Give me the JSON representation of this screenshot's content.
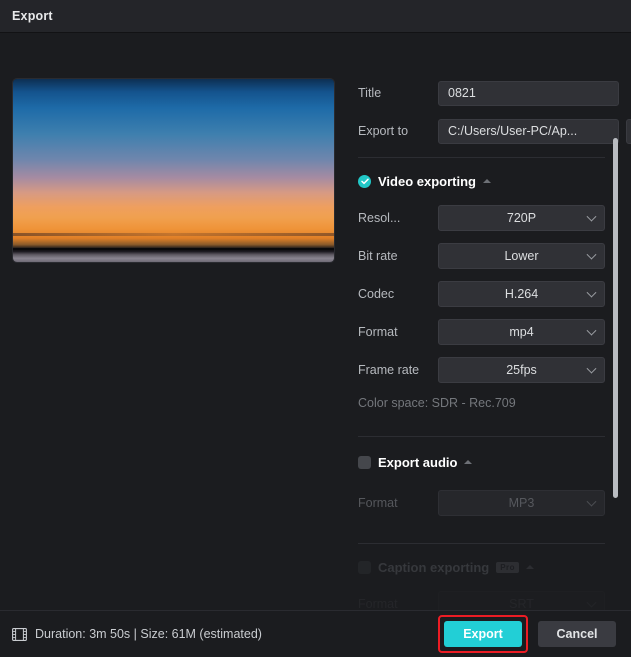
{
  "window": {
    "title": "Export"
  },
  "preview": {
    "name": "video-preview-thumbnail"
  },
  "settings": {
    "title": {
      "label": "Title",
      "value": "0821",
      "placeholder": "Title"
    },
    "export_to": {
      "label": "Export to",
      "value": "C:/Users/User-PC/Ap...",
      "placeholder": "Export path",
      "browse_icon": "folder-icon"
    },
    "video_section": {
      "label": "Video exporting",
      "checked": true,
      "caret": "chevron-up-icon",
      "fields": [
        {
          "label": "Resol...",
          "value": "720P",
          "name": "resolution"
        },
        {
          "label": "Bit rate",
          "value": "Lower",
          "name": "bitrate"
        },
        {
          "label": "Codec",
          "value": "H.264",
          "name": "codec"
        },
        {
          "label": "Format",
          "value": "mp4",
          "name": "video-format"
        },
        {
          "label": "Frame rate",
          "value": "25fps",
          "name": "framerate"
        }
      ],
      "color_space": "Color space: SDR - Rec.709"
    },
    "audio_section": {
      "label": "Export audio",
      "checked": false,
      "caret": "chevron-up-icon",
      "fields": [
        {
          "label": "Format",
          "value": "MP3",
          "name": "audio-format"
        }
      ]
    },
    "caption_section": {
      "label": "Caption exporting",
      "badge": "Pro",
      "checked": false,
      "caret": "chevron-up-icon",
      "fields": [
        {
          "label": "Format",
          "value": "SRT",
          "name": "caption-format"
        }
      ]
    }
  },
  "footer": {
    "status": "Duration: 3m 50s | Size: 61M (estimated)",
    "status_icon": "film-strip-icon",
    "export_label": "Export",
    "cancel_label": "Cancel"
  },
  "colors": {
    "accent": "#22cfd6",
    "highlight": "#ec1c24",
    "panel": "#1b1c1f",
    "titlebar": "#242529",
    "field": "#303136"
  }
}
